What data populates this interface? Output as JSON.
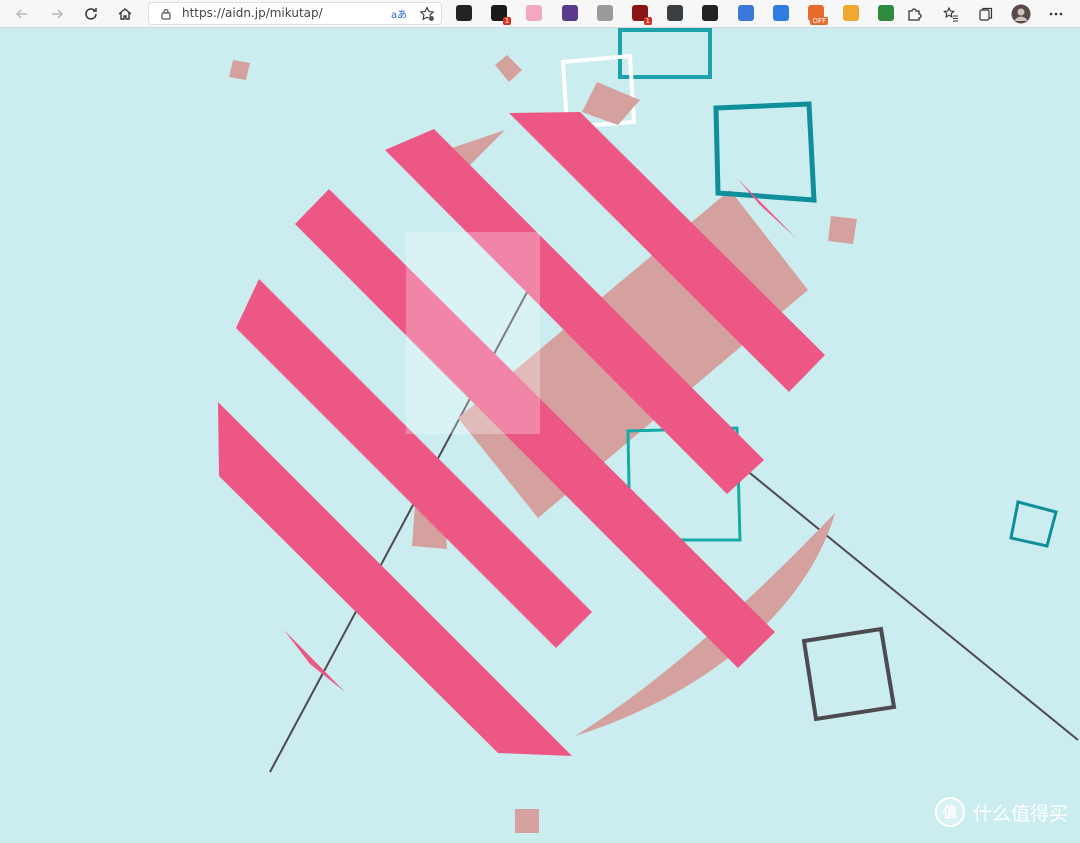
{
  "browser": {
    "url": "https://aidn.jp/mikutap/",
    "extensions": [
      {
        "name": "infinity-extension",
        "color": "#222222",
        "badge": ""
      },
      {
        "name": "todo-extension",
        "color": "#1a1a1a",
        "badge": "1"
      },
      {
        "name": "cat-extension",
        "color": "#f3a7c0",
        "badge": ""
      },
      {
        "name": "ia-extension",
        "color": "#5a3b8c",
        "badge": ""
      },
      {
        "name": "mouse-extension",
        "color": "#9a9a9a",
        "badge": ""
      },
      {
        "name": "shield-extension",
        "color": "#8b1515",
        "badge": "1"
      },
      {
        "name": "dots-extension",
        "color": "#3a3f44",
        "badge": ""
      },
      {
        "name": "camera-extension",
        "color": "#222222",
        "badge": ""
      },
      {
        "name": "bird-extension",
        "color": "#3c78d8",
        "badge": ""
      },
      {
        "name": "translate-extension",
        "color": "#2f7de1",
        "badge": ""
      },
      {
        "name": "off-extension",
        "color": "#e86b2e",
        "badge": "OFF"
      },
      {
        "name": "color-extension",
        "color": "#f0a92e",
        "badge": ""
      },
      {
        "name": "globe-extension",
        "color": "#2e8b3e",
        "badge": ""
      }
    ]
  },
  "watermark": {
    "logo_text": "值",
    "text": "什么值得买"
  },
  "colors": {
    "background": "#cbedef",
    "pink": "#ec5785",
    "rose": "#d4a19f",
    "teal": "#0e8f9b",
    "cyan": "#14aaa6",
    "dark": "#4d4a51",
    "white": "#ffffff"
  }
}
